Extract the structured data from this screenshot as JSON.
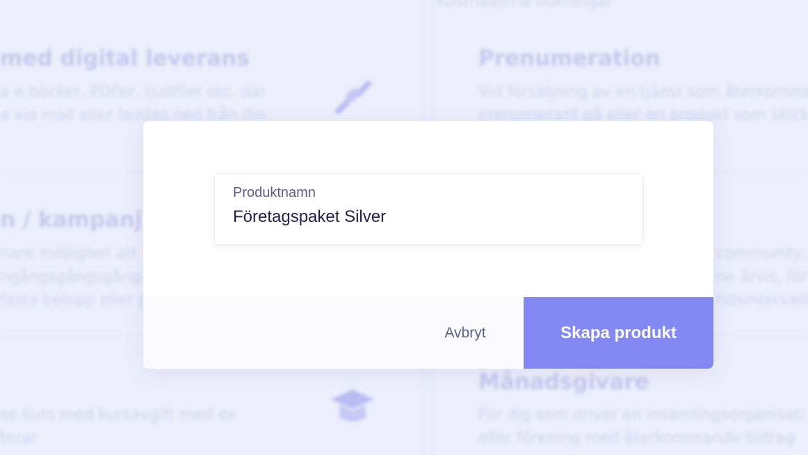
{
  "background": {
    "top_fragment": "Kostnadsfria bokningar",
    "cards": [
      {
        "heading": "med digital leverans",
        "lines": [
          "a e-böcker, PDFer, ljudfiler etc. där",
          "a via mail eller laddas ned från din"
        ],
        "icon": "link-icon"
      },
      {
        "heading": "Prenumeration",
        "lines": [
          "Vid försäljning av en tjänst som återkommer",
          "prenumerant på eller en produkt som skick"
        ]
      },
      {
        "heading": "n / kampanj",
        "lines": [
          "nare möjlighet att",
          "ngångsgångsgång",
          "fasta belopp eller p"
        ]
      },
      {
        "heading": "",
        "lines": [
          "community, ex",
          "ne årvis, för",
          "tidsintervallen."
        ]
      },
      {
        "heading": "",
        "lines": [
          "se kurs med kursavgift med ex",
          "terar"
        ],
        "icon": "graduation-cap-icon"
      },
      {
        "heading": "Månadsgivare",
        "lines": [
          "För dig som driver en insamlingsorganisati",
          "eller förening med återkommande bidrag"
        ]
      }
    ]
  },
  "dialog": {
    "field": {
      "label": "Produktnamn",
      "value": "Företagspaket Silver",
      "placeholder": "Produktnamn"
    },
    "cancel_label": "Avbryt",
    "create_label": "Skapa produkt"
  },
  "colors": {
    "accent": "#8289f2",
    "background": "#eceefb",
    "text_dark": "#23204e",
    "text_muted": "#5b5f8c"
  }
}
